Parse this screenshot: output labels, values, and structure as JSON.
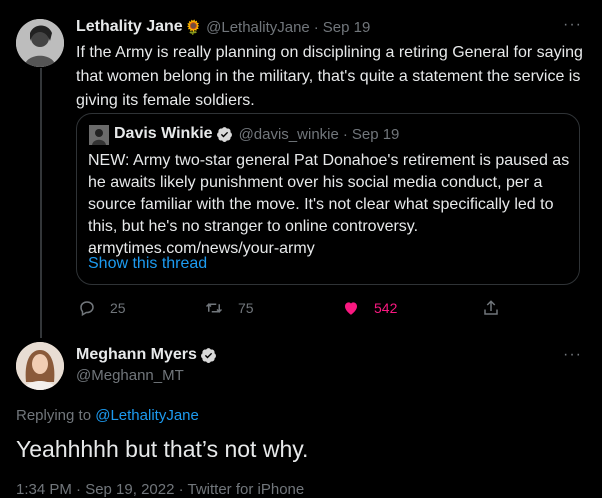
{
  "tweet": {
    "author_name": "Lethality Jane",
    "author_emoji": "🌻",
    "author_handle": "@LethalityJane",
    "date": "Sep 19",
    "separator": "·",
    "more": "···",
    "text": "If the Army is really planning on disciplining a retiring General for saying that women belong in the military, that's quite a statement the service is giving its female soldiers."
  },
  "quoted": {
    "author_name": "Davis Winkie",
    "author_handle": "@davis_winkie",
    "date": "Sep 19",
    "separator": "·",
    "text": "NEW: Army two-star general Pat Donahoe's retirement is paused as he awaits likely punishment over his social media conduct, per a source familiar with the move. It's not clear what specifically led to this, but he's no stranger to online controversy. armytimes.com/news/your-army",
    "ellipsis": "...",
    "show_thread": "Show this thread"
  },
  "actions": {
    "replies": "25",
    "retweets": "75",
    "likes": "542"
  },
  "reply": {
    "author_name": "Meghann Myers",
    "author_handle": "@Meghann_MT",
    "more": "···",
    "replying_prefix": "Replying to ",
    "replying_to": "@LethalityJane",
    "text": "Yeahhhhh but that’s not why.",
    "footer_partial": "1:34 PM · Sep 19, 2022 · Twitter for iPhone"
  },
  "colors": {
    "background": "#000000",
    "text": "#e7e9ea",
    "muted": "#71767b",
    "link": "#1d9bf0",
    "like": "#f91880",
    "verified": "#d9d9d9"
  }
}
